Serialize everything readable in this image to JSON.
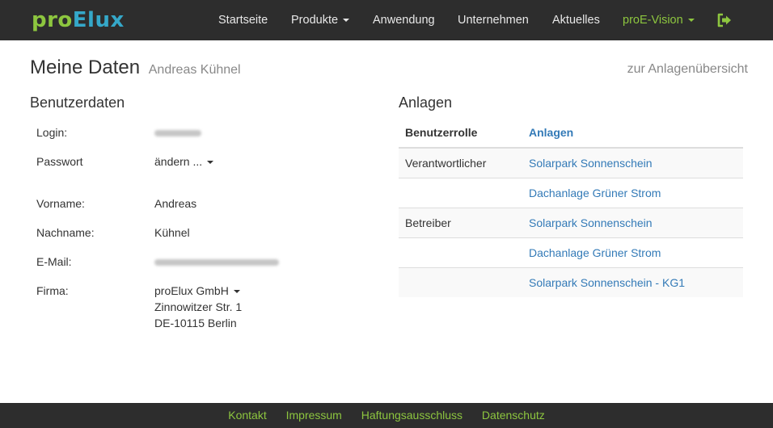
{
  "brand": {
    "part1": "pro",
    "part2": "Elux"
  },
  "nav": {
    "items": [
      {
        "label": "Startseite"
      },
      {
        "label": "Produkte"
      },
      {
        "label": "Anwendung"
      },
      {
        "label": "Unternehmen"
      },
      {
        "label": "Aktuelles"
      },
      {
        "label": "proE-Vision"
      }
    ],
    "logout_icon": "sign-out-icon"
  },
  "header": {
    "title": "Meine Daten",
    "subtitle": "Andreas Kühnel",
    "overview_link": "zur Anlagenübersicht"
  },
  "user": {
    "section_title": "Benutzerdaten",
    "login_label": "Login:",
    "password_label": "Passwort",
    "password_action": "ändern ...",
    "firstname_label": "Vorname:",
    "firstname": "Andreas",
    "lastname_label": "Nachname:",
    "lastname": "Kühnel",
    "email_label": "E-Mail:",
    "company_label": "Firma:",
    "company_name": "proElux GmbH",
    "company_street": "Zinnowitzer Str. 1",
    "company_city": "DE-10115 Berlin"
  },
  "plants": {
    "section_title": "Anlagen",
    "headers": {
      "role": "Benutzerrolle",
      "plants": "Anlagen"
    },
    "rows": [
      {
        "role": "Verantwortlicher",
        "plant": "Solarpark Sonnenschein"
      },
      {
        "role": "",
        "plant": "Dachanlage Grüner Strom"
      },
      {
        "role": "Betreiber",
        "plant": "Solarpark Sonnenschein"
      },
      {
        "role": "",
        "plant": "Dachanlage Grüner Strom"
      },
      {
        "role": "",
        "plant": "Solarpark Sonnenschein - KG1"
      }
    ]
  },
  "footer": {
    "links": [
      "Kontakt",
      "Impressum",
      "Haftungsausschluss",
      "Datenschutz"
    ]
  },
  "colors": {
    "navbar": "#2d2d2d",
    "accent_green": "#8dc63f",
    "logo_blue": "#35a8c9",
    "link_blue": "#337ab7"
  }
}
